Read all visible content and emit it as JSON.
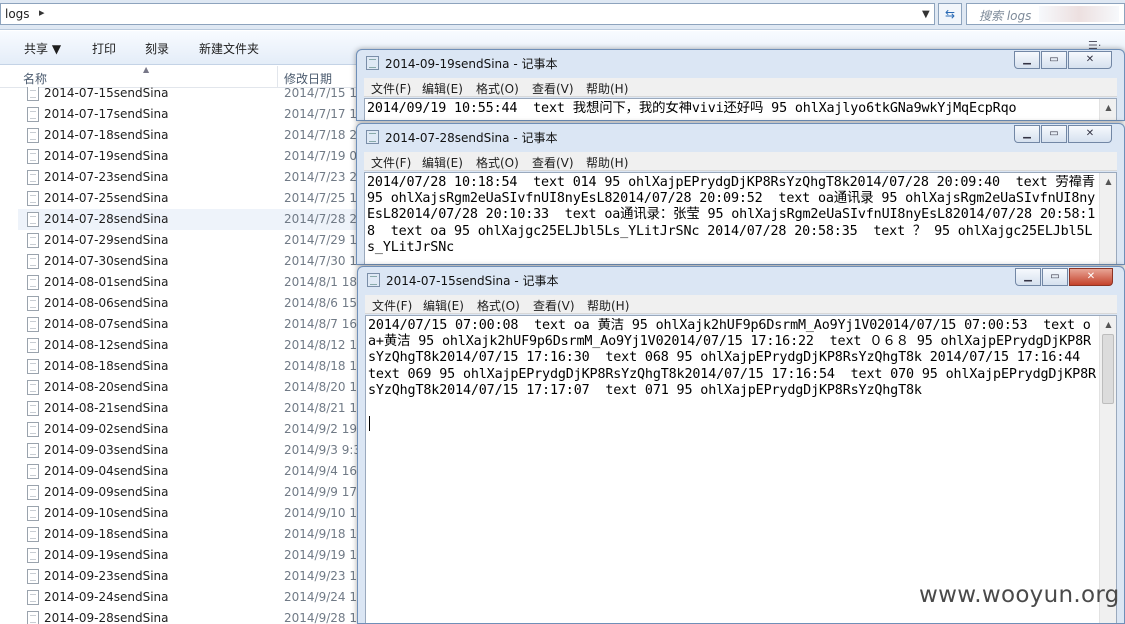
{
  "explorer": {
    "address": "logs",
    "search_placeholder": "搜索 logs",
    "toolbar": {
      "share": "共享 ▼",
      "print": "打印",
      "burn": "刻录",
      "new_folder": "新建文件夹"
    },
    "columns": {
      "name": "名称",
      "date": "修改日期"
    },
    "files": [
      {
        "name": "2014-07-15sendSina",
        "date": "2014/7/15 1"
      },
      {
        "name": "2014-07-17sendSina",
        "date": "2014/7/17 1"
      },
      {
        "name": "2014-07-18sendSina",
        "date": "2014/7/18 2"
      },
      {
        "name": "2014-07-19sendSina",
        "date": "2014/7/19 0"
      },
      {
        "name": "2014-07-23sendSina",
        "date": "2014/7/23 2"
      },
      {
        "name": "2014-07-25sendSina",
        "date": "2014/7/25 1"
      },
      {
        "name": "2014-07-28sendSina",
        "date": "2014/7/28 2"
      },
      {
        "name": "2014-07-29sendSina",
        "date": "2014/7/29 1"
      },
      {
        "name": "2014-07-30sendSina",
        "date": "2014/7/30 1"
      },
      {
        "name": "2014-08-01sendSina",
        "date": "2014/8/1 18"
      },
      {
        "name": "2014-08-06sendSina",
        "date": "2014/8/6 15"
      },
      {
        "name": "2014-08-07sendSina",
        "date": "2014/8/7 16"
      },
      {
        "name": "2014-08-12sendSina",
        "date": "2014/8/12 1"
      },
      {
        "name": "2014-08-18sendSina",
        "date": "2014/8/18 1"
      },
      {
        "name": "2014-08-20sendSina",
        "date": "2014/8/20 1"
      },
      {
        "name": "2014-08-21sendSina",
        "date": "2014/8/21 1"
      },
      {
        "name": "2014-09-02sendSina",
        "date": "2014/9/2 19"
      },
      {
        "name": "2014-09-03sendSina",
        "date": "2014/9/3 9:3"
      },
      {
        "name": "2014-09-04sendSina",
        "date": "2014/9/4 16"
      },
      {
        "name": "2014-09-09sendSina",
        "date": "2014/9/9 17"
      },
      {
        "name": "2014-09-10sendSina",
        "date": "2014/9/10 1"
      },
      {
        "name": "2014-09-18sendSina",
        "date": "2014/9/18 1"
      },
      {
        "name": "2014-09-19sendSina",
        "date": "2014/9/19 1"
      },
      {
        "name": "2014-09-23sendSina",
        "date": "2014/9/23 1"
      },
      {
        "name": "2014-09-24sendSina",
        "date": "2014/9/24 1"
      },
      {
        "name": "2014-09-28sendSina",
        "date": "2014/9/28 1"
      }
    ]
  },
  "notepad_menu": {
    "file": "文件(F)",
    "edit": "编辑(E)",
    "format": "格式(O)",
    "view": "查看(V)",
    "help": "帮助(H)"
  },
  "notepads": [
    {
      "title": "2014-09-19sendSina - 记事本",
      "content": "2014/09/19 10:55:44  text 我想问下，我的女神vivi还好吗 95 ohlXajlyo6tkGNa9wkYjMqEcpRqo"
    },
    {
      "title": "2014-07-28sendSina - 记事本",
      "content": "2014/07/28 10:18:54  text 014 95 ohlXajpEPrydgDjKP8RsYzQhgT8k2014/07/28 20:09:40  text 劳禕青 95 ohlXajsRgm2eUaSIvfnUI8nyEsL82014/07/28 20:09:52  text oa通讯录 95 ohlXajsRgm2eUaSIvfnUI8nyEsL82014/07/28 20:10:33  text oa通讯录：张莹 95 ohlXajsRgm2eUaSIvfnUI8nyEsL82014/07/28 20:58:18  text oa 95 ohlXajgc25ELJbl5Ls_YLitJrSNc 2014/07/28 20:58:35  text ？ 95 ohlXajgc25ELJbl5Ls_YLitJrSNc"
    },
    {
      "title": "2014-07-15sendSina - 记事本",
      "content": "2014/07/15 07:00:08  text oa 黄洁 95 ohlXajk2hUF9p6DsrmM_Ao9Yj1V02014/07/15 07:00:53  text oa+黄洁 95 ohlXajk2hUF9p6DsrmM_Ao9Yj1V02014/07/15 17:16:22  text ０６８ 95 ohlXajpEPrydgDjKP8RsYzQhgT8k2014/07/15 17:16:30  text 068 95 ohlXajpEPrydgDjKP8RsYzQhgT8k 2014/07/15 17:16:44  text 069 95 ohlXajpEPrydgDjKP8RsYzQhgT8k2014/07/15 17:16:54  text 070 95 ohlXajpEPrydgDjKP8RsYzQhgT8k2014/07/15 17:17:07  text 071 95 ohlXajpEPrydgDjKP8RsYzQhgT8k"
    }
  ],
  "watermark": "www.wooyun.org",
  "icons": {
    "file": "text-file-icon",
    "notepad": "notepad-icon",
    "minimize": "minimize-icon",
    "maximize": "maximize-icon",
    "close": "close-icon"
  },
  "colors": {
    "titlebar": "#dbe6f4",
    "close_active": "#c4422b",
    "selection": "#eef3fa"
  }
}
